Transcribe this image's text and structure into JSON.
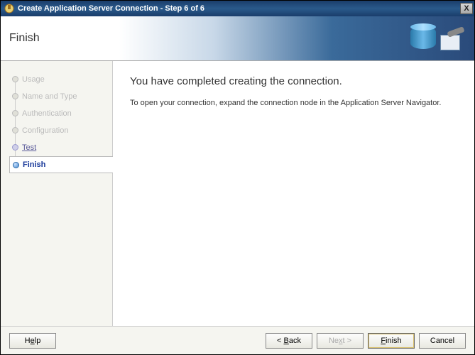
{
  "window": {
    "title": "Create Application Server Connection - Step 6 of 6",
    "close_label": "X"
  },
  "banner": {
    "heading": "Finish"
  },
  "steps": {
    "items": [
      {
        "label": "Usage"
      },
      {
        "label": "Name and Type"
      },
      {
        "label": "Authentication"
      },
      {
        "label": "Configuration"
      },
      {
        "label": "Test"
      },
      {
        "label": "Finish"
      }
    ]
  },
  "main": {
    "heading": "You have completed creating the connection.",
    "body": "To open your connection, expand the connection node in the Application Server Navigator."
  },
  "buttons": {
    "help_pre": "H",
    "help_mn": "e",
    "help_post": "lp",
    "back_pre": "< ",
    "back_mn": "B",
    "back_post": "ack",
    "next_pre": "Ne",
    "next_mn": "x",
    "next_post": "t >",
    "finish_pre": "",
    "finish_mn": "F",
    "finish_post": "inish",
    "cancel": "Cancel"
  }
}
